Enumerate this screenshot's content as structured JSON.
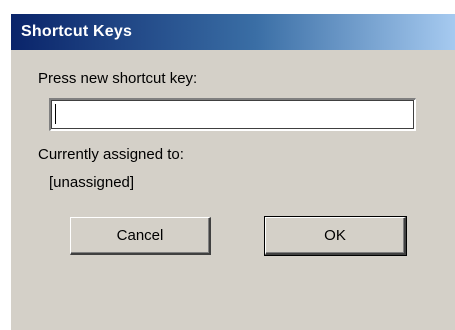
{
  "window": {
    "title": "Shortcut Keys"
  },
  "form": {
    "prompt_label": "Press new shortcut key:",
    "key_input_value": "",
    "assigned_label": "Currently assigned to:",
    "assigned_value": "[unassigned]"
  },
  "buttons": {
    "cancel_label": "Cancel",
    "ok_label": "OK"
  },
  "colors": {
    "dialog_bg": "#d4d0c8",
    "titlebar_start": "#0a246a",
    "titlebar_end": "#a6caf0",
    "title_text": "#ffffff"
  }
}
